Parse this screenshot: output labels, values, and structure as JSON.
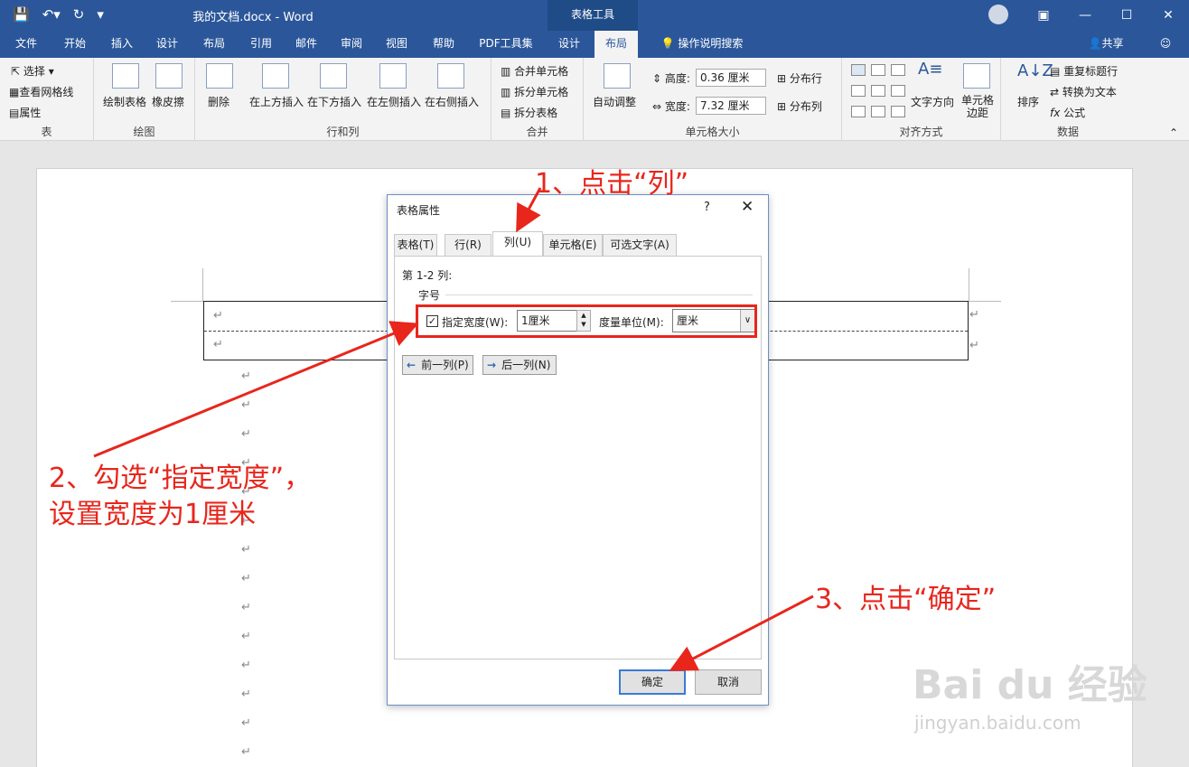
{
  "titlebar": {
    "doc_title": "我的文档.docx  -  Word",
    "tools_tab": "表格工具"
  },
  "menubar": {
    "items": [
      "文件",
      "开始",
      "插入",
      "设计",
      "布局",
      "引用",
      "邮件",
      "审阅",
      "视图",
      "帮助",
      "PDF工具集",
      "设计",
      "布局"
    ],
    "search": "操作说明搜索",
    "share": "共享"
  },
  "ribbon": {
    "table_group": {
      "select": "选择",
      "gridlines": "查看网格线",
      "properties": "属性",
      "label": "表"
    },
    "draw_group": {
      "draw": "绘制表格",
      "eraser": "橡皮擦",
      "label": "绘图"
    },
    "rowcol_group": {
      "delete": "删除",
      "above": "在上方插入",
      "below": "在下方插入",
      "left": "在左侧插入",
      "right": "在右侧插入",
      "label": "行和列"
    },
    "merge_group": {
      "merge": "合并单元格",
      "split_cells": "拆分单元格",
      "split_table": "拆分表格",
      "label": "合并"
    },
    "cellsize_group": {
      "autofit": "自动调整",
      "height_label": "高度:",
      "height_value": "0.36 厘米",
      "width_label": "宽度:",
      "width_value": "7.32 厘米",
      "dist_rows": "分布行",
      "dist_cols": "分布列",
      "label": "单元格大小"
    },
    "align_group": {
      "text_dir": "文字方向",
      "margins": "单元格边距",
      "label": "对齐方式"
    },
    "data_group": {
      "sort": "排序",
      "repeat_header": "重复标题行",
      "to_text": "转换为文本",
      "formula": "公式",
      "label": "数据"
    }
  },
  "dialog": {
    "title": "表格属性",
    "help": "?",
    "close": "✕",
    "tabs": [
      "表格(T)",
      "行(R)",
      "列(U)",
      "单元格(E)",
      "可选文字(A)"
    ],
    "columns_label": "第 1-2 列:",
    "section_label": "字号",
    "specify_width": "指定宽度(W):",
    "width_value": "1厘米",
    "unit_label": "度量单位(M):",
    "unit_value": "厘米",
    "prev_col": "前一列(P)",
    "next_col": "后一列(N)",
    "ok": "确定",
    "cancel": "取消"
  },
  "annotations": {
    "step1": "1、点击“列”",
    "step2a": "2、勾选“指定宽度”，",
    "step2b": "设置宽度为1厘米",
    "step3": "3、点击“确定”"
  },
  "watermark": {
    "brand": "Bai du 经验",
    "url": "jingyan.baidu.com"
  },
  "colors": {
    "accent": "#2b579a",
    "annotation": "#e8261c"
  }
}
